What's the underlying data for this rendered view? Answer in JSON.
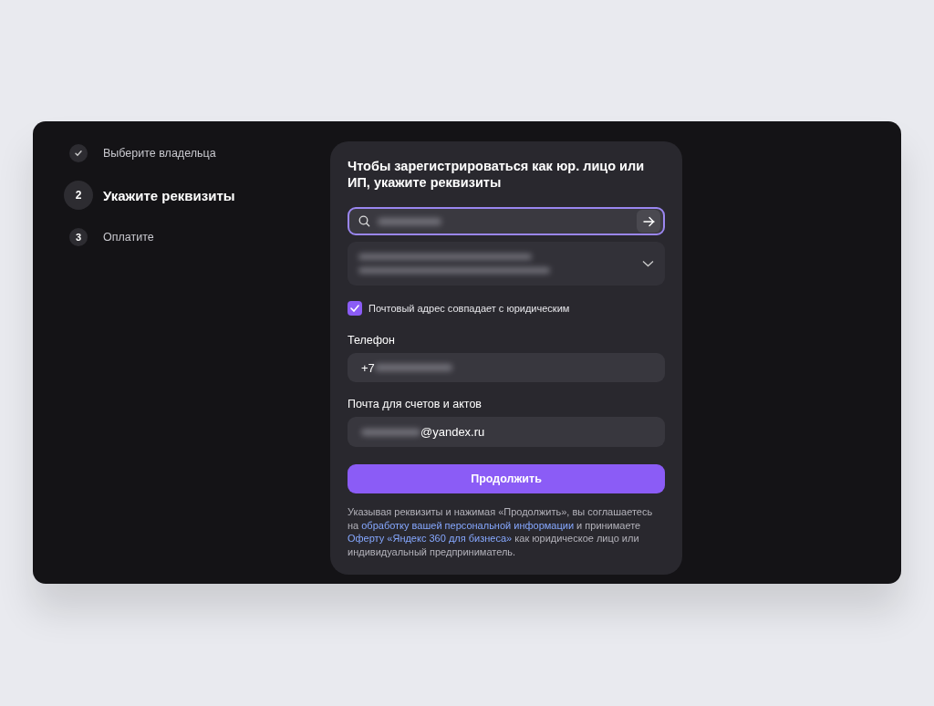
{
  "steps": [
    {
      "label": "Выберите владельца",
      "done": true,
      "selected": false
    },
    {
      "number": "2",
      "label": "Укажите реквизиты",
      "done": false,
      "selected": true
    },
    {
      "number": "3",
      "label": "Оплатите",
      "done": false,
      "selected": false
    }
  ],
  "form": {
    "title": "Чтобы зарегистрироваться как юр. лицо или ИП, укажите реквизиты",
    "search": {
      "focused": true
    },
    "postal_same": {
      "label": "Почтовый адрес совпадает с юридическим",
      "checked": true
    },
    "phone": {
      "label": "Телефон",
      "value": "+7"
    },
    "email": {
      "label": "Почта для счетов и актов",
      "value": "@yandex.ru"
    },
    "submit": "Продолжить",
    "consent": [
      {
        "text": "Указывая реквизиты и нажимая «Продолжить», вы соглашаетесь на ",
        "link": false
      },
      {
        "text": "обработку вашей персональной информации",
        "link": true
      },
      {
        "text": " и принимаете ",
        "link": false
      },
      {
        "text": "Оферту «Яндекс 360 для бизнеса»",
        "link": true
      },
      {
        "text": " как юридическое лицо или индивидуальный предприниматель.",
        "link": false
      }
    ]
  }
}
